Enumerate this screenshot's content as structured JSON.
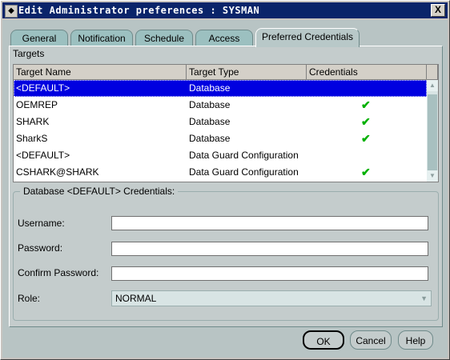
{
  "window": {
    "title": "Edit Administrator preferences : SYSMAN",
    "close_label": "X"
  },
  "tabs": [
    {
      "label": "General"
    },
    {
      "label": "Notification"
    },
    {
      "label": "Schedule"
    },
    {
      "label": "Access"
    },
    {
      "label": "Preferred Credentials"
    }
  ],
  "targets": {
    "label": "Targets",
    "columns": [
      "Target Name",
      "Target Type",
      "Credentials"
    ],
    "rows": [
      {
        "name": "<DEFAULT>",
        "type": "Database",
        "has_credentials": false,
        "selected": true
      },
      {
        "name": "OEMREP",
        "type": "Database",
        "has_credentials": true
      },
      {
        "name": "SHARK",
        "type": "Database",
        "has_credentials": true
      },
      {
        "name": "SharkS",
        "type": "Database",
        "has_credentials": true
      },
      {
        "name": "<DEFAULT>",
        "type": "Data Guard Configuration",
        "has_credentials": false
      },
      {
        "name": "CSHARK@SHARK",
        "type": "Data Guard Configuration",
        "has_credentials": true
      }
    ],
    "check_glyph": "✔"
  },
  "credentials": {
    "group_title": "Database <DEFAULT> Credentials:",
    "username_label": "Username:",
    "username_value": "",
    "password_label": "Password:",
    "password_value": "",
    "confirm_label": "Confirm Password:",
    "confirm_value": "",
    "role_label": "Role:",
    "role_value": "NORMAL"
  },
  "buttons": {
    "ok": "OK",
    "cancel": "Cancel",
    "help": "Help"
  },
  "colors": {
    "title_bar": "#0a246a",
    "selection": "#0000e0",
    "check": "#00b000",
    "panel": "#c4cccc"
  }
}
